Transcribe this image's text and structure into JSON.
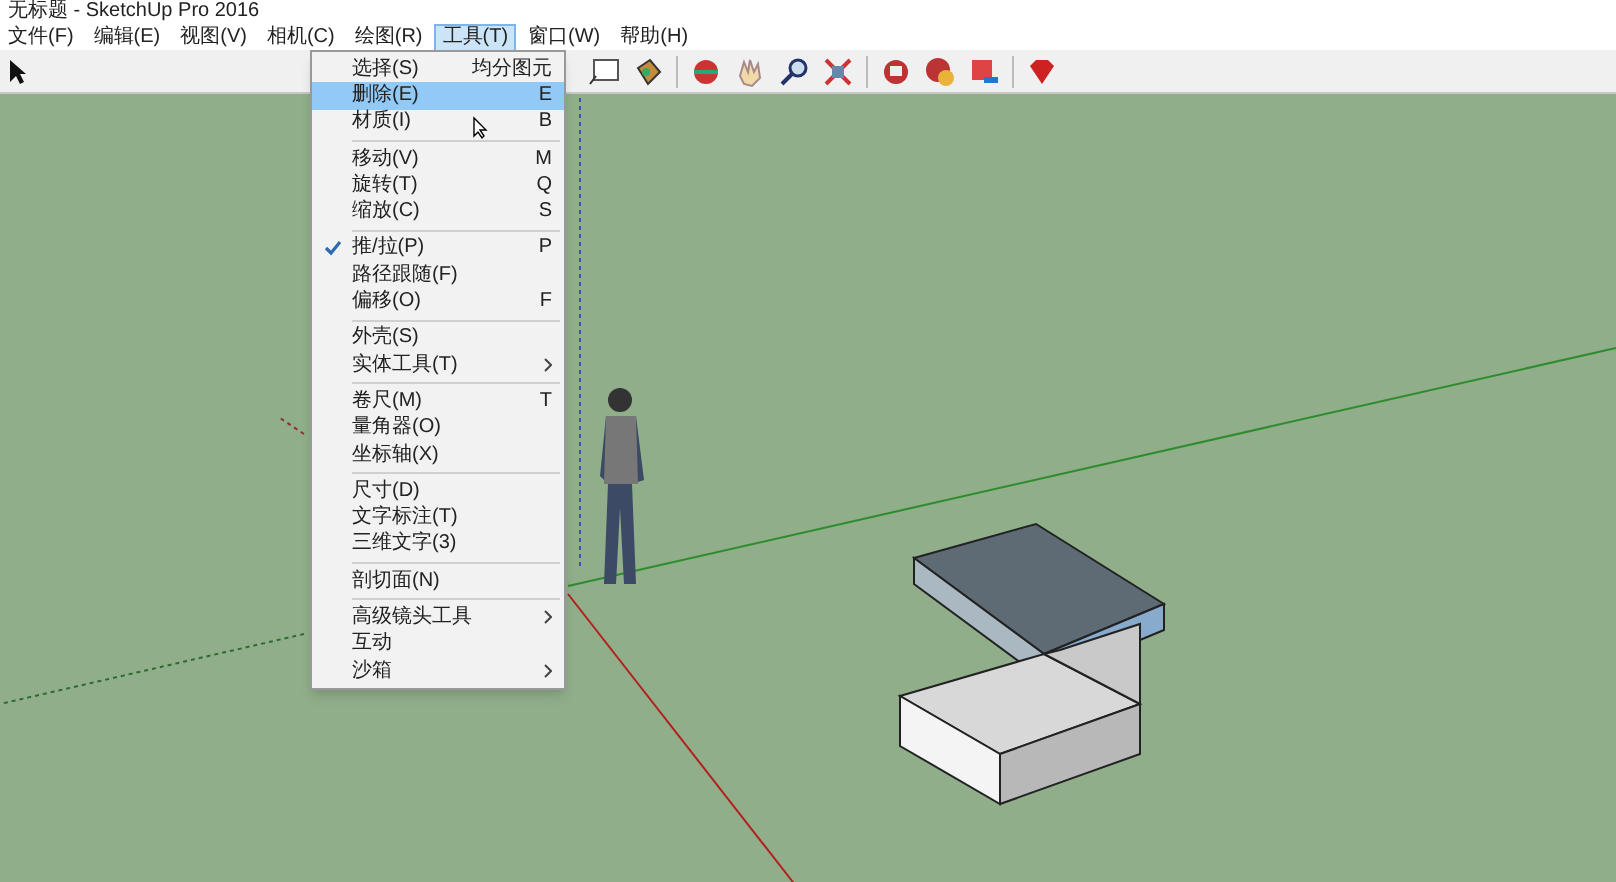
{
  "window": {
    "title": "无标题 - SketchUp Pro 2016"
  },
  "menubar": [
    {
      "label": "文件(F)",
      "selected": false
    },
    {
      "label": "编辑(E)",
      "selected": false
    },
    {
      "label": "视图(V)",
      "selected": false
    },
    {
      "label": "相机(C)",
      "selected": false
    },
    {
      "label": "绘图(R)",
      "selected": false
    },
    {
      "label": "工具(T)",
      "selected": true
    },
    {
      "label": "窗口(W)",
      "selected": false
    },
    {
      "label": "帮助(H)",
      "selected": false
    }
  ],
  "tools_menu": [
    {
      "kind": "item",
      "label": "选择(S)",
      "shortcut": "均分图元",
      "checked": false,
      "selected": false,
      "submenu": false
    },
    {
      "kind": "item",
      "label": "删除(E)",
      "shortcut": "E",
      "checked": false,
      "selected": true,
      "submenu": false
    },
    {
      "kind": "item",
      "label": "材质(I)",
      "shortcut": "B",
      "checked": false,
      "selected": false,
      "submenu": false
    },
    {
      "kind": "separator"
    },
    {
      "kind": "item",
      "label": "移动(V)",
      "shortcut": "M",
      "checked": false,
      "selected": false,
      "submenu": false
    },
    {
      "kind": "item",
      "label": "旋转(T)",
      "shortcut": "Q",
      "checked": false,
      "selected": false,
      "submenu": false
    },
    {
      "kind": "item",
      "label": "缩放(C)",
      "shortcut": "S",
      "checked": false,
      "selected": false,
      "submenu": false
    },
    {
      "kind": "separator"
    },
    {
      "kind": "item",
      "label": "推/拉(P)",
      "shortcut": "P",
      "checked": true,
      "selected": false,
      "submenu": false
    },
    {
      "kind": "item",
      "label": "路径跟随(F)",
      "checked": false,
      "selected": false,
      "submenu": false
    },
    {
      "kind": "item",
      "label": "偏移(O)",
      "shortcut": "F",
      "checked": false,
      "selected": false,
      "submenu": false
    },
    {
      "kind": "separator"
    },
    {
      "kind": "item",
      "label": "外壳(S)",
      "checked": false,
      "selected": false,
      "submenu": false
    },
    {
      "kind": "item",
      "label": "实体工具(T)",
      "checked": false,
      "selected": false,
      "submenu": true
    },
    {
      "kind": "separator"
    },
    {
      "kind": "item",
      "label": "卷尺(M)",
      "shortcut": "T",
      "checked": false,
      "selected": false,
      "submenu": false
    },
    {
      "kind": "item",
      "label": "量角器(O)",
      "checked": false,
      "selected": false,
      "submenu": false
    },
    {
      "kind": "item",
      "label": "坐标轴(X)",
      "checked": false,
      "selected": false,
      "submenu": false
    },
    {
      "kind": "separator"
    },
    {
      "kind": "item",
      "label": "尺寸(D)",
      "checked": false,
      "selected": false,
      "submenu": false
    },
    {
      "kind": "item",
      "label": "文字标注(T)",
      "checked": false,
      "selected": false,
      "submenu": false
    },
    {
      "kind": "item",
      "label": "三维文字(3)",
      "checked": false,
      "selected": false,
      "submenu": false
    },
    {
      "kind": "separator"
    },
    {
      "kind": "item",
      "label": "剖切面(N)",
      "checked": false,
      "selected": false,
      "submenu": false
    },
    {
      "kind": "separator"
    },
    {
      "kind": "item",
      "label": "高级镜头工具",
      "checked": false,
      "selected": false,
      "submenu": true
    },
    {
      "kind": "item",
      "label": "互动",
      "checked": false,
      "selected": false,
      "submenu": false
    },
    {
      "kind": "item",
      "label": "沙箱",
      "checked": false,
      "selected": false,
      "submenu": true
    }
  ]
}
